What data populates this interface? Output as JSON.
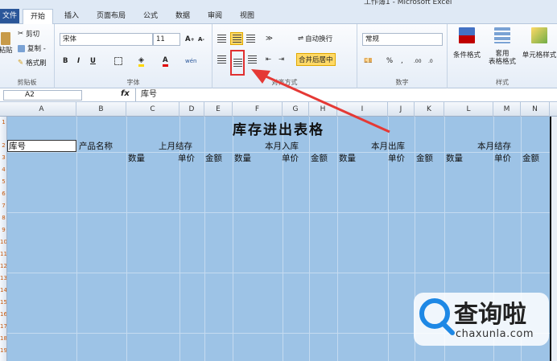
{
  "title_bar": {
    "text": "工作簿1 - Microsoft Excel"
  },
  "tabs": [
    "文件",
    "开始",
    "插入",
    "页面布局",
    "公式",
    "数据",
    "审阅",
    "视图"
  ],
  "ribbon": {
    "clipboard": {
      "paste": "粘贴",
      "cut": "剪切",
      "copy": "复制 -",
      "format_painter": "格式刷",
      "label": "剪贴板"
    },
    "font": {
      "name": "宋体",
      "size": "11",
      "label": "字体",
      "bold": "B",
      "italic": "I",
      "underline": "U",
      "wen": "wén"
    },
    "alignment": {
      "wrap": "自动换行",
      "merge": "合并后居中",
      "label": "对齐方式"
    },
    "number": {
      "format": "常规",
      "percent": "%",
      "comma": ",",
      "label": "数字"
    },
    "styles": {
      "cond": "条件格式",
      "table": "套用\n表格格式",
      "cell": "单元格样式",
      "label": "样式"
    }
  },
  "formula_bar": {
    "name_box": "A2",
    "fx": "fx",
    "value": "库号"
  },
  "columns": [
    "A",
    "B",
    "C",
    "D",
    "E",
    "F",
    "G",
    "H",
    "I",
    "J",
    "K",
    "L",
    "M",
    "N"
  ],
  "rows": [
    "1",
    "2",
    "3",
    "4",
    "5",
    "6",
    "7",
    "8",
    "9",
    "10",
    "11",
    "12",
    "13",
    "14",
    "15",
    "16",
    "17",
    "18",
    "19"
  ],
  "sheet": {
    "title": "库存进出表格",
    "row2": {
      "a": "库号",
      "b": "产品名称",
      "c": "上月结存",
      "f": "本月入库",
      "i": "本月出库",
      "l": "本月结存"
    },
    "row3": [
      "数量",
      "单价",
      "金额",
      "数量",
      "单价",
      "金额",
      "数量",
      "单价",
      "金额",
      "数量",
      "单价",
      "金额"
    ]
  },
  "watermark": {
    "brand": "查询啦",
    "url": "chaxunla.com"
  }
}
